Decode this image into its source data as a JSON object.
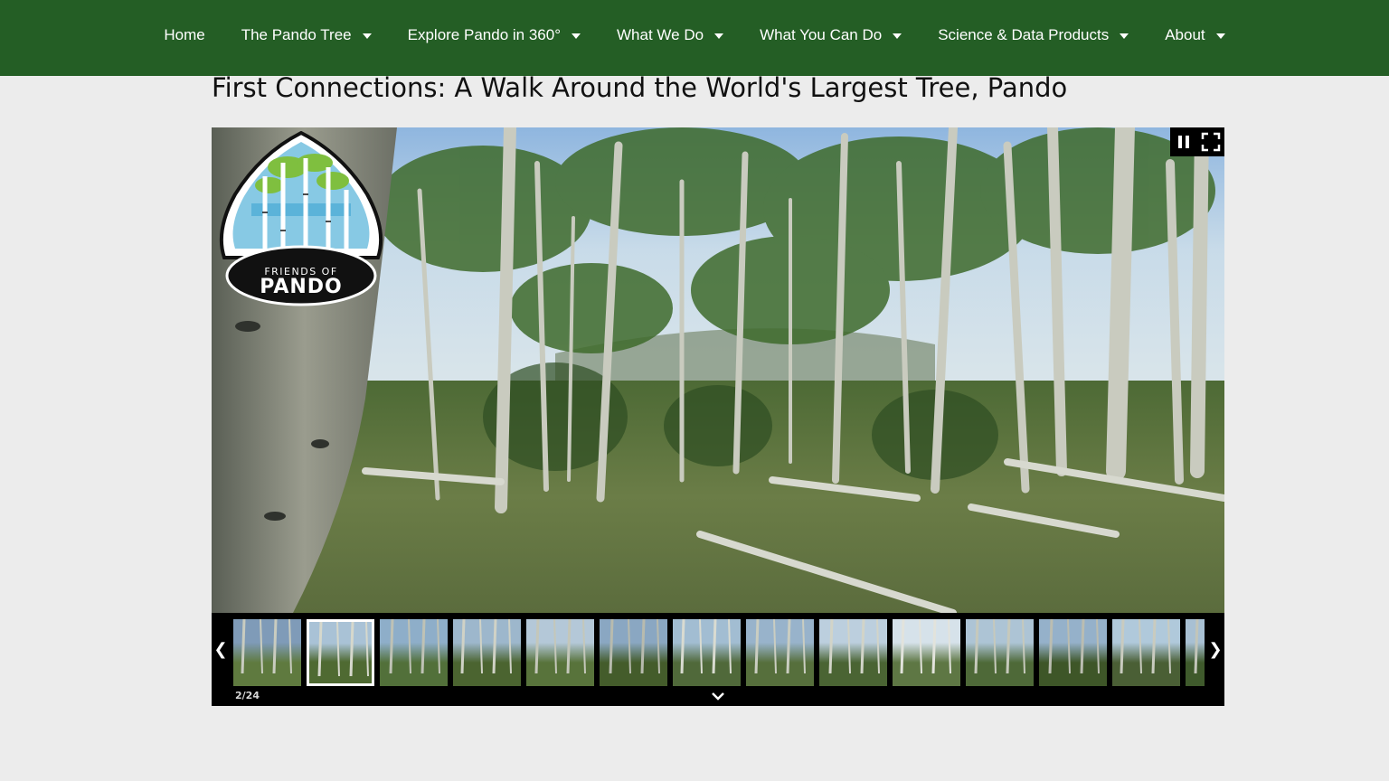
{
  "nav": {
    "items": [
      {
        "label": "Home",
        "dropdown": false
      },
      {
        "label": "The Pando Tree",
        "dropdown": true
      },
      {
        "label": "Explore Pando in 360°",
        "dropdown": true
      },
      {
        "label": "What We Do",
        "dropdown": true
      },
      {
        "label": "What You Can Do",
        "dropdown": true
      },
      {
        "label": "Science & Data Products",
        "dropdown": true
      },
      {
        "label": "About",
        "dropdown": true
      }
    ]
  },
  "page": {
    "title": "First Connections: A Walk Around the World's Largest Tree, Pando"
  },
  "viewer": {
    "logo": {
      "line1": "FRIENDS OF",
      "line2": "PANDO"
    },
    "controls": {
      "pause_icon": "pause-icon",
      "fullscreen_icon": "fullscreen-icon"
    }
  },
  "gallery": {
    "counter": "2/24",
    "selected_index": 1,
    "thumb_count_visible": 14,
    "prev_icon": "chevron-left-icon",
    "next_icon": "chevron-right-icon",
    "collapse_icon": "chevron-down-icon"
  },
  "colors": {
    "nav_bg": "#245e25",
    "page_bg": "#ececec",
    "strip_bg": "#000000"
  }
}
